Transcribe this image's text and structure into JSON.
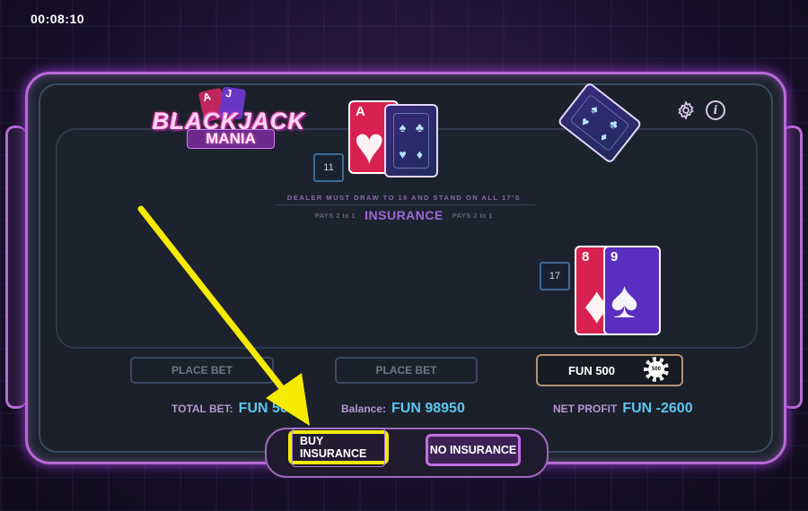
{
  "timer": "00:08:10",
  "logo": {
    "line1": "BLACKJACK",
    "line2": "MANIA",
    "card1": "A",
    "card2": "J"
  },
  "icons": {
    "settings": "gear-icon",
    "info": "info-icon"
  },
  "dealer": {
    "score": "11",
    "card_rank": "A"
  },
  "player": {
    "score": "17",
    "cards": [
      "8",
      "9"
    ]
  },
  "table_text": {
    "rules": "DEALER MUST DRAW TO 16 AND STAND ON ALL 17'S",
    "pays_left": "PAYS 2  to 1",
    "insurance": "INSURANCE",
    "pays_right": "PAYS 2  to 1"
  },
  "bets": {
    "place_bet_1": "PLACE BET",
    "place_bet_2": "PLACE BET",
    "active_bet": "FUN 500",
    "chip": "500"
  },
  "stats": {
    "total_bet_label": "TOTAL BET:",
    "total_bet_value": "FUN 500",
    "balance_label": "Balance:",
    "balance_value": "FUN 98950",
    "net_profit_label": "NET PROFIT",
    "net_profit_value": "FUN -2600"
  },
  "actions": {
    "buy_insurance": "BUY INSURANCE",
    "no_insurance": "NO INSURANCE"
  },
  "colors": {
    "highlight": "#f5ea00",
    "accent": "#b76bd6",
    "value": "#5cc6ef"
  }
}
